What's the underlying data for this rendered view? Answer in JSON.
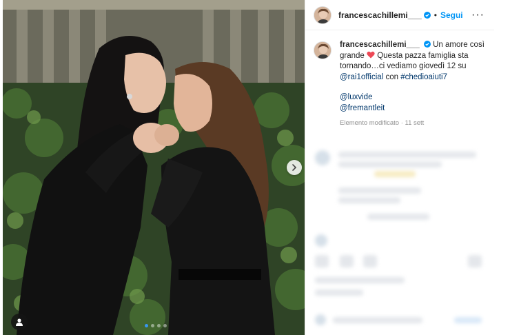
{
  "post": {
    "carousel_dots": 4,
    "active_dot": 0
  },
  "header": {
    "username": "francescachillemi___",
    "separator": "•",
    "follow_label": "Segui",
    "more_label": "···"
  },
  "caption": {
    "username": "francescachillemi___",
    "text_part1": "Un amore così grande",
    "text_part2": "Questa pazza famiglia sta tornando…ci vediamo giovedì 12 su",
    "mention_1": "@rai1official",
    "text_part3": "con",
    "hashtag": "#chedioaiuti7",
    "mention_2": "@luxvide",
    "mention_3": "@fremantleit",
    "meta": "Elemento modificato · 11 sett"
  },
  "colors": {
    "accent": "#0095f6",
    "link": "#00376b",
    "heart": "#ed4956",
    "muted": "#8e8e8e"
  },
  "icons": {
    "verified": "verified-badge-icon",
    "heart": "heart-icon",
    "nav": "chevron-right-icon",
    "tag": "user-tag-icon"
  }
}
